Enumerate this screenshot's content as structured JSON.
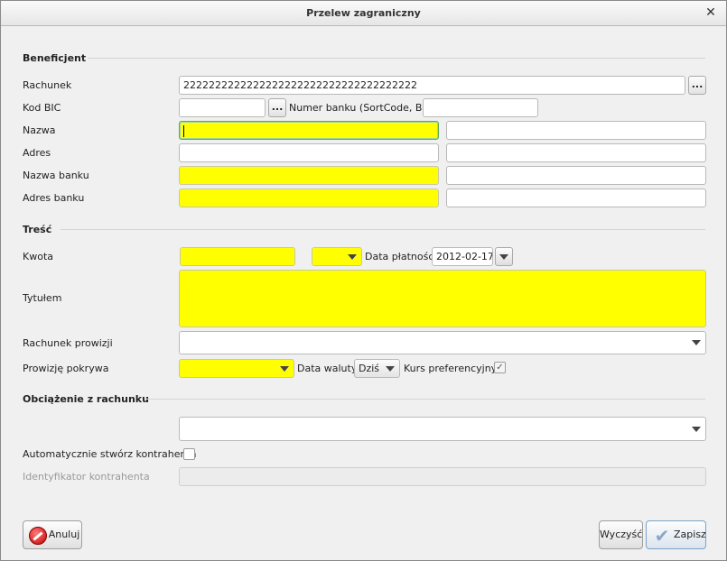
{
  "window": {
    "title": "Przelew zagraniczny",
    "close_glyph": "✕"
  },
  "beneficjent": {
    "section_title": "Beneficjent",
    "rachunek": {
      "label": "Rachunek",
      "value": "2222222222222222222222222222222222222"
    },
    "kod_bic": {
      "label": "Kod BIC",
      "value": ""
    },
    "numer_banku": {
      "label": "Numer banku (SortCode, BLZ)",
      "value": ""
    },
    "nazwa": {
      "label": "Nazwa",
      "value": "",
      "value2": ""
    },
    "adres": {
      "label": "Adres",
      "value": "",
      "value2": ""
    },
    "nazwa_banku": {
      "label": "Nazwa banku",
      "value": "",
      "value2": ""
    },
    "adres_banku": {
      "label": "Adres banku",
      "value": "",
      "value2": ""
    },
    "browse_glyph": "..."
  },
  "tresc": {
    "section_title": "Treść",
    "kwota": {
      "label": "Kwota",
      "value": "",
      "currency": ""
    },
    "data_platnosci": {
      "label": "Data płatności",
      "value": "2012-02-17"
    },
    "tytulem": {
      "label": "Tytułem",
      "value": ""
    },
    "rachunek_prowizji": {
      "label": "Rachunek prowizji",
      "value": ""
    },
    "prowizje_pokrywa": {
      "label": "Prowizję pokrywa",
      "value": ""
    },
    "data_waluty": {
      "label": "Data waluty",
      "value": "Dziś"
    },
    "kurs_preferencyjny": {
      "label": "Kurs preferencyjny",
      "checked": true,
      "glyph": "✓"
    }
  },
  "obciazenie": {
    "section_title": "Obciążenie z rachunku",
    "rachunek": {
      "value": ""
    },
    "auto_kontrahent": {
      "label": "Automatycznie stwórz kontrahenta",
      "checked": false
    },
    "identyfikator": {
      "label": "Identyfikator kontrahenta",
      "value": ""
    }
  },
  "buttons": {
    "anuluj": "Anuluj",
    "wyczysc": "Wyczyść",
    "zapisz": "Zapisz",
    "check_glyph": "✔"
  },
  "colors": {
    "required_field": "#ffff00",
    "focus_border": "#5fa85f"
  }
}
